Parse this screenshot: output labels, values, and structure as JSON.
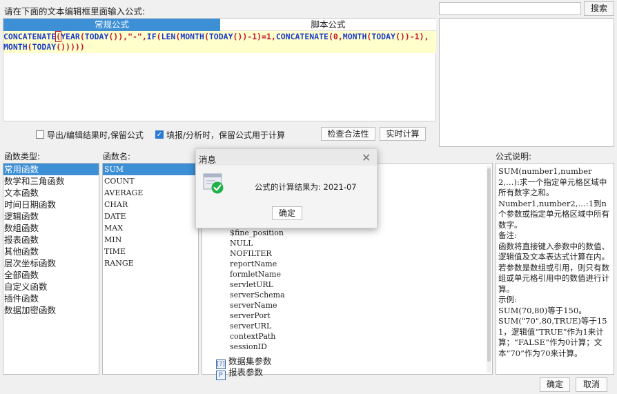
{
  "prompt_label": "请在下面的文本编辑框里面输入公式:",
  "editor": {
    "tabs": [
      "常规公式",
      "脚本公式"
    ],
    "line1": [
      {
        "t": "CONCATENATE",
        "c": "fn"
      },
      {
        "t": "(",
        "c": "par"
      },
      {
        "t": "YEAR",
        "c": "fn"
      },
      {
        "t": "(",
        "c": "par"
      },
      {
        "t": "TODAY",
        "c": "fn"
      },
      {
        "t": "()),",
        "c": "par"
      },
      {
        "t": "\"-\"",
        "c": "str"
      },
      {
        "t": ",",
        "c": "par"
      },
      {
        "t": "IF",
        "c": "fn"
      },
      {
        "t": "(",
        "c": "par"
      },
      {
        "t": "LEN",
        "c": "fn"
      },
      {
        "t": "(",
        "c": "par"
      },
      {
        "t": "MONTH",
        "c": "fn"
      },
      {
        "t": "(",
        "c": "par"
      },
      {
        "t": "TODAY",
        "c": "fn"
      },
      {
        "t": "())-1)=1,",
        "c": "par"
      },
      {
        "t": "CONCATENATE",
        "c": "fn"
      },
      {
        "t": "(0,",
        "c": "par"
      },
      {
        "t": "MONTH",
        "c": "fn"
      },
      {
        "t": "(",
        "c": "par"
      },
      {
        "t": "TODAY",
        "c": "fn"
      },
      {
        "t": "())-1),",
        "c": "par"
      }
    ],
    "line2": [
      {
        "t": "MONTH",
        "c": "fn"
      },
      {
        "t": "(",
        "c": "par"
      },
      {
        "t": "TODAY",
        "c": "fn"
      },
      {
        "t": "()))))",
        "c": "par"
      }
    ]
  },
  "search": {
    "value": "",
    "button": "搜索"
  },
  "options": {
    "export_keep": "导出/编辑结果时,保留公式",
    "export_checked": false,
    "fill_keep": "填报/分析时，保留公式用于计算",
    "fill_checked": true,
    "check_button": "检查合法性",
    "calc_button": "实时计算"
  },
  "headers": {
    "type": "函数类型:",
    "name": "函数名:",
    "desc": "公式说明:"
  },
  "function_types": [
    "常用函数",
    "数学和三角函数",
    "文本函数",
    "时间日期函数",
    "逻辑函数",
    "数组函数",
    "报表函数",
    "其他函数",
    "层次坐标函数",
    "全部函数",
    "自定义函数",
    "插件函数",
    "数据加密函数"
  ],
  "selected_type_index": 0,
  "function_names": [
    "SUM",
    "COUNT",
    "AVERAGE",
    "CHAR",
    "DATE",
    "MAX",
    "MIN",
    "TIME",
    "RANGE"
  ],
  "selected_name_index": 0,
  "tree_params": [
    "$fine_position",
    "NULL",
    "NOFILTER",
    "reportName",
    "formletName",
    "servletURL",
    "serverSchema",
    "serverName",
    "serverPort",
    "serverURL",
    "contextPath",
    "sessionID"
  ],
  "tree_groups": [
    {
      "icon_text": "[?]",
      "label": "数据集参数"
    },
    {
      "icon_text": "P",
      "label": "报表参数"
    }
  ],
  "description": [
    "SUM(number1,number2,…):求一个指定单元格区域中所有数字之和。",
    "Number1,number2,…:1到n个参数或指定单元格区域中所有数字。",
    "备注:",
    "函数将直接键入参数中的数值、逻辑值及文本表达式计算在内。若参数是数组或引用，则只有数组或单元格引用中的数值进行计算。",
    "示例:",
    "SUM(70,80)等于150。",
    "SUM(\"70\",80,TRUE)等于151，逻辑值“TRUE”作为1来计算；“FALSE”作为0计算；文本“70”作为70来计算。"
  ],
  "bottom": {
    "ok": "确定",
    "cancel": "取消"
  },
  "dialog": {
    "title": "消息",
    "message": "公式的计算结果为: 2021-07",
    "ok": "确定",
    "icon": "success-check-icon",
    "success_color": "#22b04b"
  }
}
